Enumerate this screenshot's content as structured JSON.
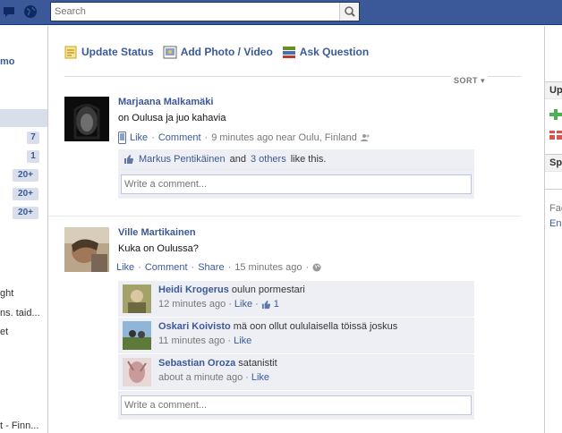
{
  "search": {
    "placeholder": "Search"
  },
  "left": {
    "name_fragment": "mo",
    "counts": [
      "7",
      "1",
      "20+",
      "20+",
      "20+"
    ],
    "fragments": [
      "ght",
      "ns. taid...",
      "et",
      "t - Finn..."
    ]
  },
  "composer": {
    "update_status": "Update Status",
    "add_photo": "Add Photo / Video",
    "ask_question": "Ask Question"
  },
  "sort_label": "SORT",
  "stories": [
    {
      "author": "Marjaana Malkamäki",
      "message": "on Oulusa ja juo kahavia",
      "like": "Like",
      "comment": "Comment",
      "sep": "·",
      "time": "9 minutes ago near Oulu, Finland",
      "likers": {
        "name": "Markus Pentikäinen",
        "and": "and",
        "others": "3 others",
        "tail": "like this."
      },
      "comment_placeholder": "Write a comment..."
    },
    {
      "author": "Ville Martikainen",
      "message": "Kuka on Oulussa?",
      "like": "Like",
      "comment": "Comment",
      "share": "Share",
      "sep": "·",
      "time": "15 minutes ago",
      "comments": [
        {
          "author": "Heidi Krogerus",
          "text": "oulun pormestari",
          "time": "12 minutes ago",
          "like": "Like",
          "likes": "1"
        },
        {
          "author": "Oskari Koivisto",
          "text": "mä oon ollut oululaisella töissä joskus",
          "time": "11 minutes ago",
          "like": "Like"
        },
        {
          "author": "Sebastian Oroza",
          "text": "satanistit",
          "time": "about a minute ago",
          "like": "Like"
        }
      ],
      "comment_placeholder": "Write a comment..."
    }
  ],
  "right": {
    "header1": "Up",
    "header2": "Sp",
    "frag1": "Fac",
    "frag2": "Eng"
  },
  "colors": {
    "brand": "#3b5998",
    "ufi_bg": "#edeff4"
  }
}
